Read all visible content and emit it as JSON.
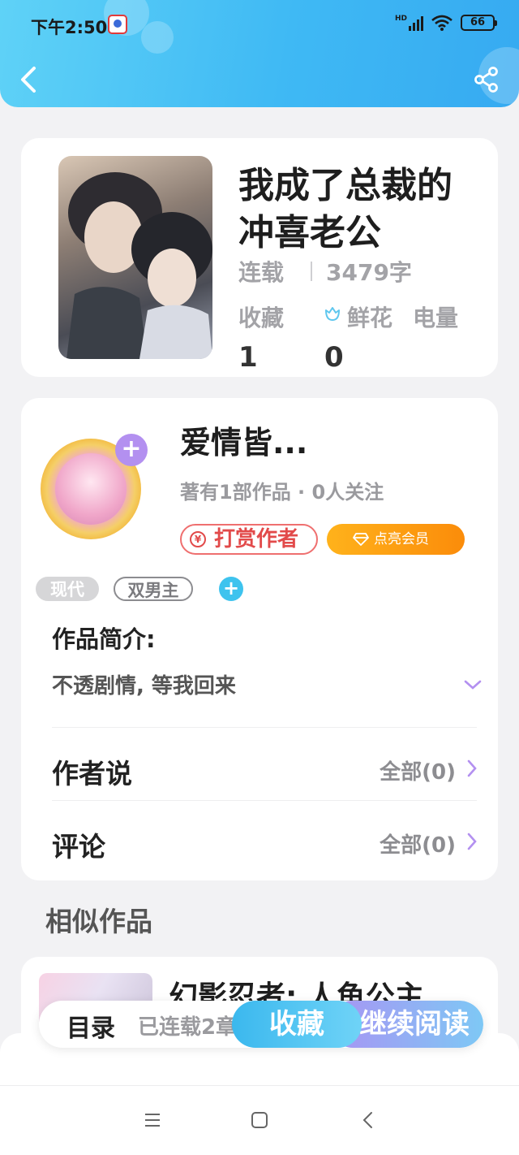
{
  "status_bar": {
    "time": "下午2:50",
    "network": "HD",
    "battery": "66"
  },
  "book": {
    "title": "我成了总裁的冲喜老公",
    "status": "连载",
    "word_count": "3479字",
    "favorites_label": "收藏",
    "flowers_label": "鲜花",
    "power_label": "电量",
    "favorites_value": "1",
    "flowers_value": "0"
  },
  "author": {
    "name": "爱情皆...",
    "meta": "著有1部作品 · 0人关注",
    "reward_label": "打赏作者",
    "vip_label": "点亮会员"
  },
  "tags": [
    "现代",
    "双男主"
  ],
  "intro": {
    "title": "作品简介:",
    "text": "不透剧情, 等我回来"
  },
  "rows": [
    {
      "label": "作者说",
      "value": "全部(0)"
    },
    {
      "label": "评论",
      "value": "全部(0)"
    }
  ],
  "similar": {
    "title": "相似作品",
    "first_title": "幻影忍者: 人鱼公主"
  },
  "bottom_bar": {
    "catalog_label": "目录",
    "serial_text": "已连载2章",
    "collect_label": "收藏",
    "read_label": "继续阅读"
  },
  "colors": {
    "header_start": "#5fd2f7",
    "header_end": "#36aaf1",
    "accent_orange": "#fb8c0a",
    "accent_purple": "#b390f0"
  }
}
